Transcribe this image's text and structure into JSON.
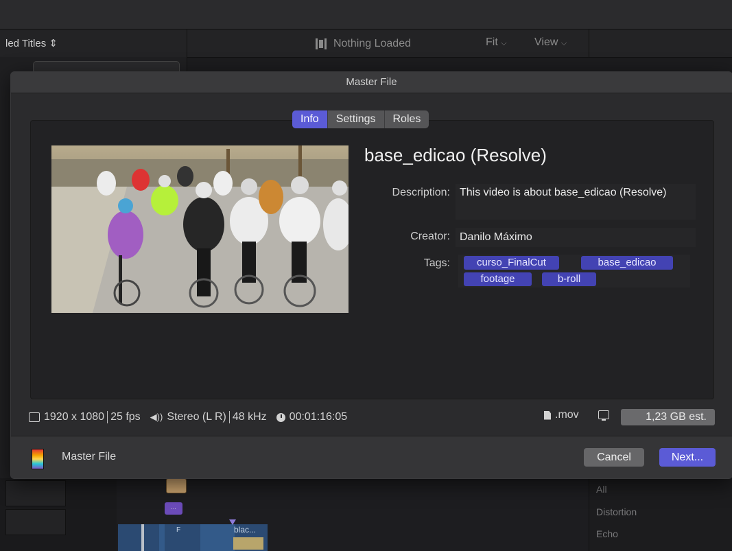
{
  "background": {
    "browser_title": "led Titles",
    "viewer_status": "Nothing Loaded",
    "fit_menu": "Fit",
    "view_menu": "View",
    "timeline_clip_label": "blac...",
    "timeline_clip_small": "F",
    "purple_clip_label": "...",
    "effects_items": [
      "All",
      "Distortion",
      "Echo"
    ]
  },
  "dialog": {
    "title": "Master File",
    "tabs": [
      {
        "label": "Info",
        "active": true
      },
      {
        "label": "Settings",
        "active": false
      },
      {
        "label": "Roles",
        "active": false
      }
    ],
    "file_title": "base_edicao (Resolve)",
    "description_label": "Description:",
    "description_value": "This video is about base_edicao (Resolve)",
    "creator_label": "Creator:",
    "creator_value": "Danilo Máximo",
    "tags_label": "Tags:",
    "tags": [
      "curso_FinalCut",
      "base_edicao",
      "footage",
      "b-roll"
    ],
    "info": {
      "resolution": "1920 x 1080",
      "fps": "25 fps",
      "audio": "Stereo (L R)",
      "sample_rate": "48 kHz",
      "duration": "00:01:16:05",
      "format": ".mov",
      "size": "1,23 GB est."
    },
    "footer_label": "Master File",
    "cancel_label": "Cancel",
    "next_label": "Next..."
  },
  "colors": {
    "accent": "#5b5bd6",
    "tag": "#4343b3"
  }
}
